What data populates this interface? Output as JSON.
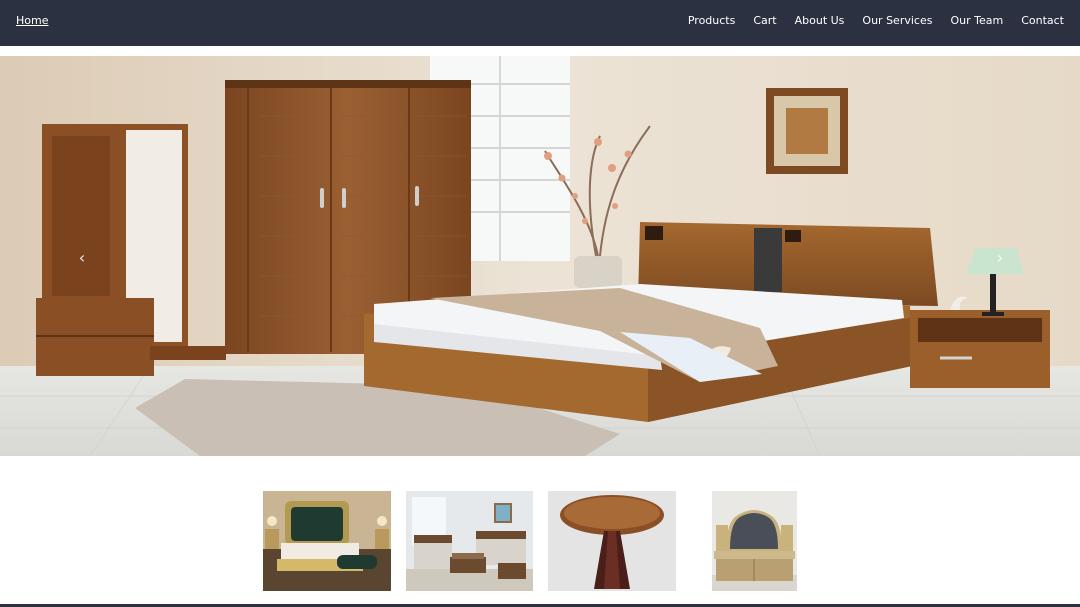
{
  "nav": {
    "home_label": "Home",
    "links": [
      {
        "label": "Products",
        "name": "nav-products"
      },
      {
        "label": "Cart",
        "name": "nav-cart"
      },
      {
        "label": "About Us",
        "name": "nav-about-us"
      },
      {
        "label": "Our Services",
        "name": "nav-our-services"
      },
      {
        "label": "Our Team",
        "name": "nav-our-team"
      },
      {
        "label": "Contact",
        "name": "nav-contact"
      }
    ]
  },
  "carousel": {
    "prev_icon": "chevron-left-icon",
    "next_icon": "chevron-right-icon",
    "prev_glyph": "‹",
    "next_glyph": "›"
  },
  "thumbnails": [
    {
      "name": "thumbnail-bedroom-set"
    },
    {
      "name": "thumbnail-living-room-sofas"
    },
    {
      "name": "thumbnail-round-table"
    },
    {
      "name": "thumbnail-dressing-table"
    }
  ],
  "colors": {
    "navbar": "#2b3141",
    "wall": "#e8dccb",
    "wood": "#8a5328",
    "floor": "#e3e3df"
  }
}
